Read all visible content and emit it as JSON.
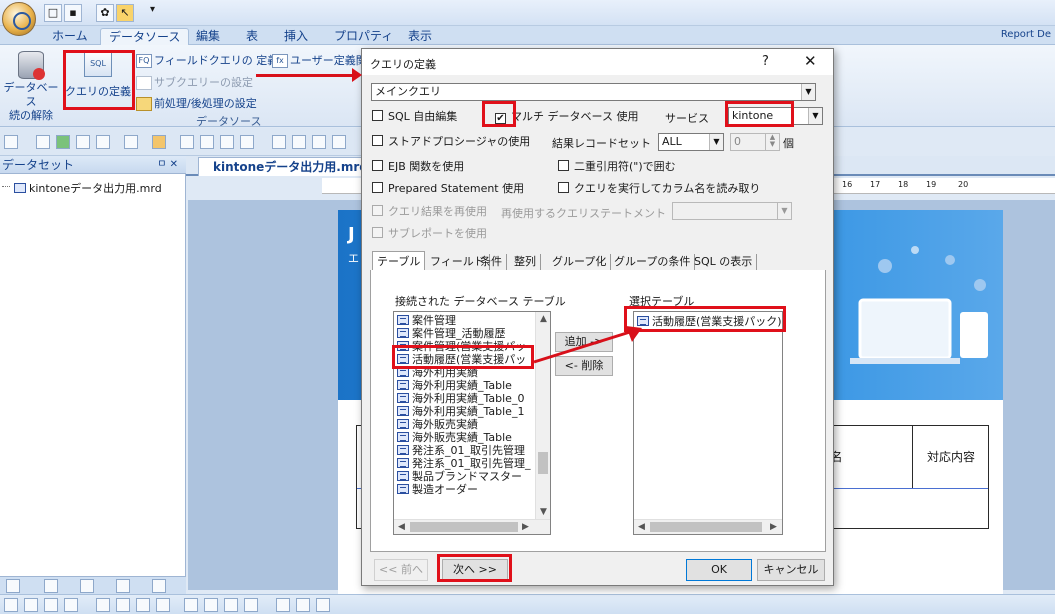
{
  "ribbon_tabs": [
    "ホーム",
    "データソース",
    "編集",
    "表",
    "挿入",
    "プロパティ",
    "表示"
  ],
  "active_tab_index": 1,
  "report_label": "Report De",
  "ribbon": {
    "db_btn_label": "データベース\n続の解除",
    "sql_icon_text": "SQL",
    "query_def_label": "クエリの定義",
    "field_query_def": "フィールドクエリの 定義",
    "user_def": "ユーザー定義関",
    "subquery_setting": "サブクエリーの設定",
    "preprocess_setting": "前処理/後処理の設定",
    "group_label": "データソース"
  },
  "left_panel": {
    "header": "データセット",
    "pin_close": "ㅁ ✕",
    "tree_item": "kintoneデータ出力用.mrd"
  },
  "doc_tab": "kintoneデータ出力用.mrd*",
  "ruler_numbers": [
    "16",
    "17",
    "18",
    "19",
    "20"
  ],
  "report_preview": {
    "banner_letter": "J",
    "banner_sub": "エ",
    "col_customer": "顧客名",
    "col_response": "対応内容"
  },
  "dialog": {
    "title": "クエリの定義",
    "help": "?",
    "close": "✕",
    "main_query": "メインクエリ",
    "sql_free_edit": "SQL 自由編集",
    "multi_db": "マルチ データベース 使用",
    "multi_db_checked": "✔",
    "service_label": "サービス",
    "service_value": "kintone",
    "stored_proc": "ストアドプロシージャの使用",
    "result_recordset_label": "結果レコードセット",
    "result_recordset_value": "ALL",
    "result_count_value": "0",
    "count_unit": "個",
    "ejb": "EJB 関数を使用",
    "double_quote": "二重引用符(\")で囲む",
    "prepared_stmt": "Prepared Statement 使用",
    "run_query_cols": "クエリを実行してカラム名を読み取り",
    "reuse_result": "クエリ結果を再使用",
    "reuse_stmt_label": "再使用するクエリステートメント",
    "subreport": "サブレポートを使用",
    "tabs": [
      "テーブル",
      "フィールド",
      "条件",
      "整列",
      "グループ化",
      "グループの条件",
      "SQL の表示"
    ],
    "connected_tables_label": "接続された データベース テーブル",
    "selected_tables_label": "選択テーブル",
    "connected_tables": [
      "案件管理",
      "案件管理_活動履歴",
      "案件管理(営業支援パッ",
      "活動履歴(営業支援パッ",
      "海外利用実績",
      "海外利用実績_Table",
      "海外利用実績_Table_0",
      "海外利用実績_Table_1",
      "海外販売実績",
      "海外販売実績_Table",
      "発注系_01_取引先管理",
      "発注系_01_取引先管理_",
      "製品ブランドマスター",
      "製造オーダー"
    ],
    "selected_tables": [
      "活動履歴(営業支援パック)"
    ],
    "add_btn": "追加 ->",
    "remove_btn": "<- 削除",
    "prev_btn": "<< 前へ",
    "next_btn": "次へ >>",
    "ok_btn": "OK",
    "cancel_btn": "キャンセル"
  },
  "colors": {
    "highlight": "#e0101a",
    "ribbon_text": "#15428b",
    "banner": "#1b73c7"
  }
}
